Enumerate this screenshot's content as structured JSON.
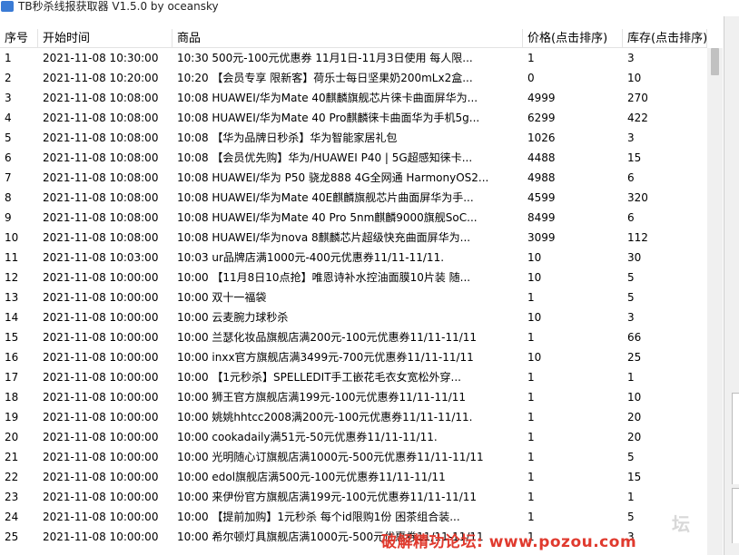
{
  "window": {
    "title": "TB秒杀线报获取器 V1.5.0 by oceansky"
  },
  "table": {
    "columns": [
      "序号",
      "开始时间",
      "商品",
      "价格(点击排序)",
      "库存(点击排序)"
    ],
    "rows": [
      [
        "1",
        "2021-11-08  10:30:00",
        "10:30  500元-100元优惠券 11月1日-11月3日使用 每人限...",
        "1",
        "3"
      ],
      [
        "2",
        "2021-11-08  10:20:00",
        "10:20 【会员专享 限新客】荷乐士每日坚果奶200mLx2盒...",
        "0",
        "10"
      ],
      [
        "3",
        "2021-11-08  10:08:00",
        "10:08 HUAWEI/华为Mate 40麒麟旗舰芯片徕卡曲面屏华为...",
        "4999",
        "270"
      ],
      [
        "4",
        "2021-11-08  10:08:00",
        "10:08 HUAWEI/华为Mate 40 Pro麒麟徕卡曲面华为手机5g...",
        "6299",
        "422"
      ],
      [
        "5",
        "2021-11-08  10:08:00",
        "10:08 【华为品牌日秒杀】华为智能家居礼包",
        "1026",
        "3"
      ],
      [
        "6",
        "2021-11-08  10:08:00",
        "10:08 【会员优先购】华为/HUAWEI P40 | 5G超感知徕卡...",
        "4488",
        "15"
      ],
      [
        "7",
        "2021-11-08  10:08:00",
        "10:08 HUAWEI/华为 P50 骁龙888 4G全网通 HarmonyOS2...",
        "4988",
        "6"
      ],
      [
        "8",
        "2021-11-08  10:08:00",
        "10:08 HUAWEI/华为Mate 40E麒麟旗舰芯片曲面屏华为手...",
        "4599",
        "320"
      ],
      [
        "9",
        "2021-11-08  10:08:00",
        "10:08 HUAWEI/华为Mate 40 Pro   5nm麒麟9000旗舰SoC...",
        "8499",
        "6"
      ],
      [
        "10",
        "2021-11-08  10:08:00",
        "10:08 HUAWEI/华为nova 8麒麟芯片超级快充曲面屏华为...",
        "3099",
        "112"
      ],
      [
        "11",
        "2021-11-08  10:03:00",
        "10:03  ur品牌店满1000元-400元优惠券11/11-11/11.",
        "10",
        "30"
      ],
      [
        "12",
        "2021-11-08  10:00:00",
        "10:00 【11月8日10点抢】唯恩诗补水控油面膜10片装 随...",
        "10",
        "5"
      ],
      [
        "13",
        "2021-11-08  10:00:00",
        "10:00 双十一福袋",
        "1",
        "5"
      ],
      [
        "14",
        "2021-11-08  10:00:00",
        "10:00 云麦腕力球秒杀",
        "10",
        "3"
      ],
      [
        "15",
        "2021-11-08  10:00:00",
        "10:00 兰瑟化妆品旗舰店满200元-100元优惠券11/11-11/11",
        "1",
        "66"
      ],
      [
        "16",
        "2021-11-08  10:00:00",
        "10:00 inxx官方旗舰店满3499元-700元优惠券11/11-11/11",
        "10",
        "25"
      ],
      [
        "17",
        "2021-11-08  10:00:00",
        "10:00  【1元秒杀】SPELLEDIT手工嵌花毛衣女宽松外穿...",
        "1",
        "1"
      ],
      [
        "18",
        "2021-11-08  10:00:00",
        "10:00 狮王官方旗舰店满199元-100元优惠券11/11-11/11",
        "1",
        "10"
      ],
      [
        "19",
        "2021-11-08  10:00:00",
        "10:00  姚姚hhtcc2008满200元-100元优惠券11/11-11/11.",
        "1",
        "20"
      ],
      [
        "20",
        "2021-11-08  10:00:00",
        "10:00  cookadaily满51元-50元优惠券11/11-11/11.",
        "1",
        "20"
      ],
      [
        "21",
        "2021-11-08  10:00:00",
        "10:00 光明随心订旗舰店满1000元-500元优惠券11/11-11/11",
        "1",
        "5"
      ],
      [
        "22",
        "2021-11-08  10:00:00",
        "10:00 edol旗舰店满500元-100元优惠券11/11-11/11",
        "1",
        "15"
      ],
      [
        "23",
        "2021-11-08  10:00:00",
        "10:00 来伊份官方旗舰店满199元-100元优惠券11/11-11/11",
        "1",
        "1"
      ],
      [
        "24",
        "2021-11-08  10:00:00",
        "10:00 【提前加购】1元秒杀 每个id限购1份 困茶组合装...",
        "1",
        "5"
      ],
      [
        "25",
        "2021-11-08  10:00:00",
        "10:00 希尔顿灯具旗舰店满1000元-500元优惠券11/11-11/11",
        "1",
        "3"
      ]
    ]
  },
  "watermark": {
    "text": "破解精功论坛: www.pozou.com",
    "logo_text": "坛"
  }
}
